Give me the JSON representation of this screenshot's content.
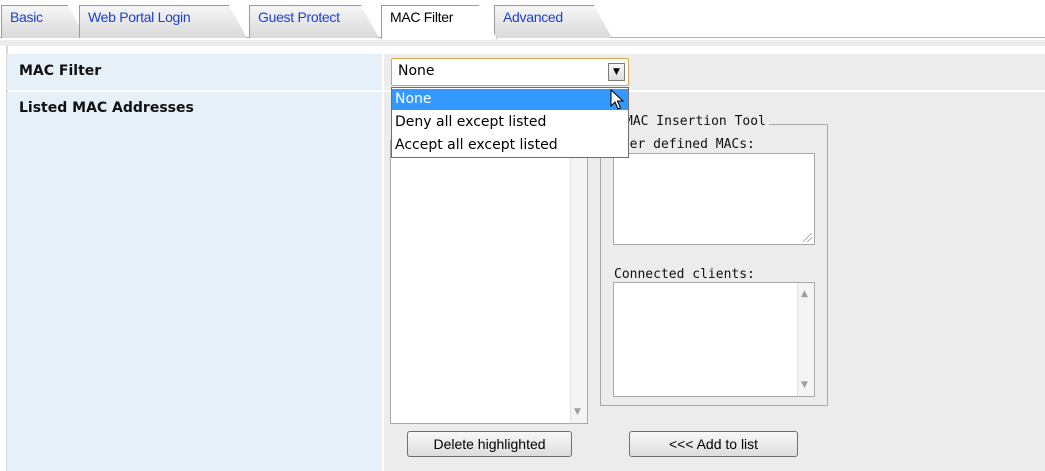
{
  "tabs": [
    {
      "label": "Basic"
    },
    {
      "label": "Web Portal Login"
    },
    {
      "label": "Guest Protect"
    },
    {
      "label": "MAC Filter"
    },
    {
      "label": "Advanced"
    }
  ],
  "active_tab": "MAC Filter",
  "mac_filter": {
    "label": "MAC Filter",
    "selected": "None",
    "options": [
      "None",
      "Deny all except listed",
      "Accept all except listed"
    ],
    "highlighted_option": "None"
  },
  "listed_macs": {
    "label": "Listed MAC Addresses",
    "entries": []
  },
  "insertion_tool": {
    "legend": "MAC Insertion Tool",
    "user_defined_label": "User defined MACs:",
    "user_defined_value": "",
    "connected_label": "Connected clients:",
    "connected_entries": []
  },
  "buttons": {
    "delete": "Delete highlighted",
    "add": "<<< Add to list"
  },
  "colors": {
    "tab_link": "#1a3fd6",
    "label_bg": "#e6f0f8",
    "value_bg": "#ececec",
    "highlight": "#3399ff",
    "select_border": "#d6a64e"
  }
}
